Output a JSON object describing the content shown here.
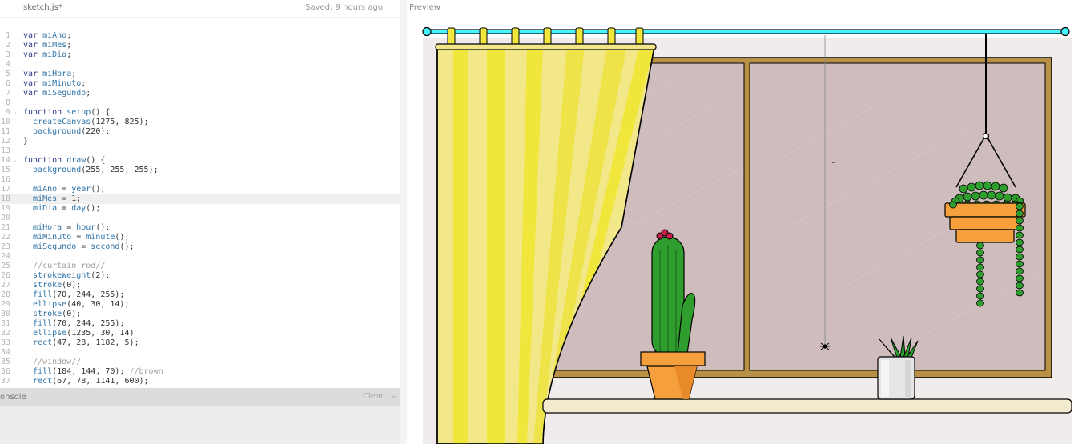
{
  "editor": {
    "file_name": "sketch.js*",
    "saved_status": "Saved: 9 hours ago",
    "lines": [
      {
        "n": "1",
        "text": "var miAno;"
      },
      {
        "n": "2",
        "text": "var miMes;"
      },
      {
        "n": "3",
        "text": "var miDia;"
      },
      {
        "n": "4",
        "text": ""
      },
      {
        "n": "5",
        "text": "var miHora;"
      },
      {
        "n": "6",
        "text": "var miMinuto;"
      },
      {
        "n": "7",
        "text": "var miSegundo;"
      },
      {
        "n": "8",
        "text": ""
      },
      {
        "n": "9",
        "text": "function setup() {",
        "fold": true
      },
      {
        "n": "10",
        "text": "  createCanvas(1275, 825);"
      },
      {
        "n": "11",
        "text": "  background(220);"
      },
      {
        "n": "12",
        "text": "}"
      },
      {
        "n": "13",
        "text": ""
      },
      {
        "n": "14",
        "text": "function draw() {",
        "fold": true
      },
      {
        "n": "15",
        "text": "  background(255, 255, 255);"
      },
      {
        "n": "16",
        "text": ""
      },
      {
        "n": "17",
        "text": "  miAno = year();"
      },
      {
        "n": "18",
        "text": "  miMes = 1;",
        "highlight": true
      },
      {
        "n": "19",
        "text": "  miDia = day();"
      },
      {
        "n": "20",
        "text": ""
      },
      {
        "n": "21",
        "text": "  miHora = hour();"
      },
      {
        "n": "22",
        "text": "  miMinuto = minute();"
      },
      {
        "n": "23",
        "text": "  miSegundo = second();"
      },
      {
        "n": "24",
        "text": ""
      },
      {
        "n": "25",
        "text": "  //curtain rod//"
      },
      {
        "n": "26",
        "text": "  strokeWeight(2);"
      },
      {
        "n": "27",
        "text": "  stroke(0);"
      },
      {
        "n": "28",
        "text": "  fill(70, 244, 255);"
      },
      {
        "n": "29",
        "text": "  ellipse(40, 30, 14);"
      },
      {
        "n": "30",
        "text": "  stroke(0);"
      },
      {
        "n": "31",
        "text": "  fill(70, 244, 255);"
      },
      {
        "n": "32",
        "text": "  ellipse(1235, 30, 14)"
      },
      {
        "n": "33",
        "text": "  rect(47, 28, 1182, 5);"
      },
      {
        "n": "34",
        "text": ""
      },
      {
        "n": "35",
        "text": "  //window//"
      },
      {
        "n": "36",
        "text": "  fill(184, 144, 70); //brown"
      },
      {
        "n": "37",
        "text": "  rect(67, 78, 1141, 600);"
      }
    ]
  },
  "console": {
    "label": "onsole",
    "clear_label": "Clear",
    "chevron": "⌄"
  },
  "preview": {
    "label": "Preview"
  },
  "colors": {
    "rod": "#46f4ff",
    "window_frame": "#b89046",
    "glass": "#cfbcbd",
    "wall": "#f0ecec",
    "curtain": "#f0e63c",
    "curtain_light": "#f2e88a",
    "sill": "#f3ebcf",
    "pot": "#f5a03c",
    "cactus": "#2f9e2f",
    "flower": "#c8204a",
    "plant_pot": "#e6e6e6"
  }
}
